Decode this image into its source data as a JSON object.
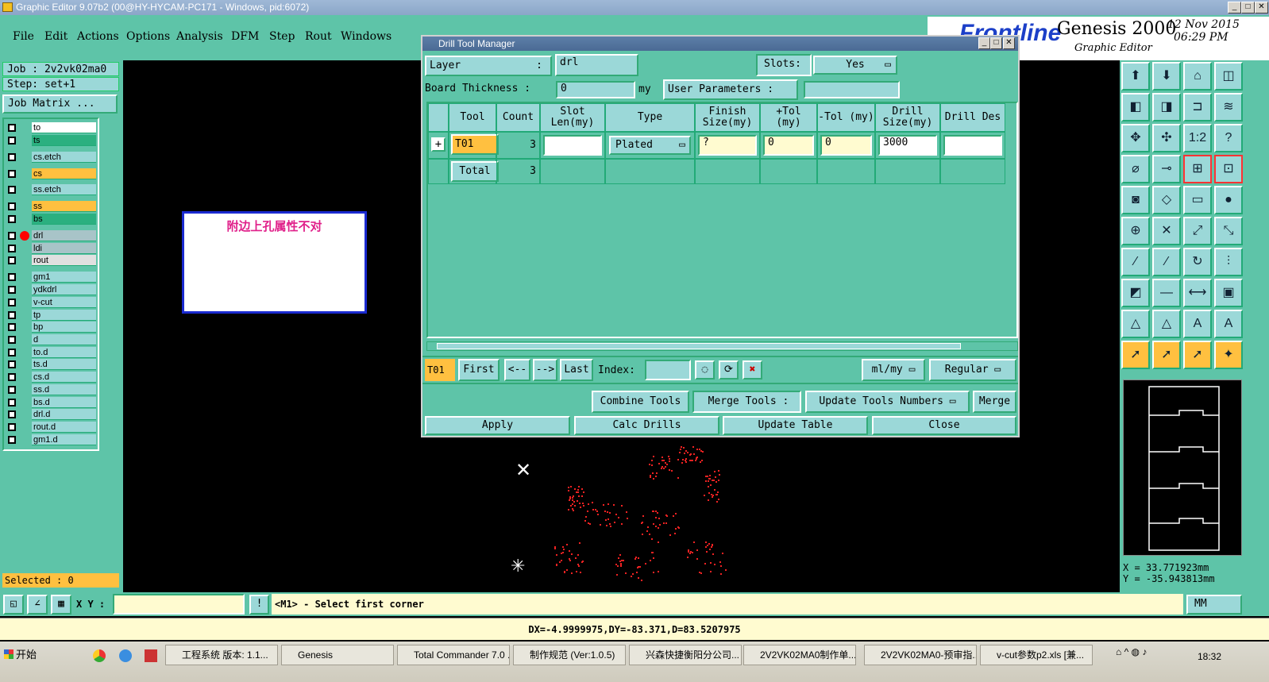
{
  "window": {
    "title": "Graphic Editor 9.07b2 (00@HY-HYCAM-PC171 - Windows, pid:6072)"
  },
  "menu": [
    "File",
    "Edit",
    "Actions",
    "Options",
    "Analysis",
    "DFM",
    "Step",
    "Rout",
    "Windows"
  ],
  "brand": {
    "logo": "Frontline",
    "product": "Genesis 2000",
    "subtitle": "Graphic Editor",
    "date": "12 Nov 2015",
    "time": "06:29 PM"
  },
  "job": {
    "job": "Job : 2v2vk02ma0",
    "step": "Step: set+1",
    "matrix_button": "Job Matrix ..."
  },
  "layers": [
    {
      "name": "to",
      "color": "#ffffff"
    },
    {
      "name": "ts",
      "color": "#2bb080"
    },
    {
      "name": "cs.etch",
      "color": "#9bd8d8"
    },
    {
      "name": "cs",
      "color": "#ffc040"
    },
    {
      "name": "ss.etch",
      "color": "#9bd8d8"
    },
    {
      "name": "ss",
      "color": "#ffc040"
    },
    {
      "name": "bs",
      "color": "#2bb080"
    },
    {
      "name": "drl",
      "color": "#a8c4c8"
    },
    {
      "name": "ldi",
      "color": "#a8c4c8"
    },
    {
      "name": "rout",
      "color": "#e0e0e0"
    },
    {
      "name": "gm1",
      "color": "#9bd8d8"
    },
    {
      "name": "ydkdrl",
      "color": "#9bd8d8"
    },
    {
      "name": "v-cut",
      "color": "#9bd8d8"
    },
    {
      "name": "tp",
      "color": "#9bd8d8"
    },
    {
      "name": "bp",
      "color": "#9bd8d8"
    },
    {
      "name": "d",
      "color": "#9bd8d8"
    },
    {
      "name": "to.d",
      "color": "#9bd8d8"
    },
    {
      "name": "ts.d",
      "color": "#9bd8d8"
    },
    {
      "name": "cs.d",
      "color": "#9bd8d8"
    },
    {
      "name": "ss.d",
      "color": "#9bd8d8"
    },
    {
      "name": "bs.d",
      "color": "#9bd8d8"
    },
    {
      "name": "drl.d",
      "color": "#9bd8d8"
    },
    {
      "name": "rout.d",
      "color": "#9bd8d8"
    },
    {
      "name": "gm1.d",
      "color": "#9bd8d8"
    }
  ],
  "selected": "Selected : 0",
  "note": "附边上孔属性不对",
  "dialog": {
    "title": "Drill Tool Manager",
    "layer_label": "Layer",
    "layer_colon": ":",
    "layer_value": "drl",
    "slots_label": "Slots:",
    "slots_value": "Yes",
    "board_thickness_label": "Board Thickness :",
    "board_thickness_value": "0",
    "board_thickness_unit": "my",
    "user_params_label": "User Parameters :",
    "user_params_value": "",
    "columns": [
      "Tool",
      "Count",
      "Slot Len(my)",
      "Type",
      "Finish Size(my)",
      "+Tol (my)",
      "-Tol (my)",
      "Drill Size(my)",
      "Drill Des"
    ],
    "rows": [
      {
        "tool": "T01",
        "count": "3",
        "slot_len": "",
        "type": "Plated",
        "finish": "?",
        "plus_tol": "0",
        "minus_tol": "0",
        "drill_size": "3000",
        "drill_des": ""
      }
    ],
    "total_label": "Total",
    "total_count": "3",
    "current_tool": "T01",
    "nav": {
      "first": "First",
      "prev": "<--",
      "next": "-->",
      "last": "Last",
      "index_label": "Index:",
      "index_value": ""
    },
    "units": "ml/my",
    "mode": "Regular",
    "combine": "Combine Tools",
    "merge_label": "Merge Tools :",
    "update_numbers": "Update Tools Numbers",
    "merge": "Merge",
    "apply": "Apply",
    "calc": "Calc Drills",
    "update_table": "Update Table",
    "close": "Close"
  },
  "coords": {
    "x": "X = 33.771923mm",
    "y": "Y = -35.943813mm"
  },
  "status": {
    "xy_label": "X Y :",
    "xy_value": "",
    "prompt": "<M1> - Select first corner",
    "units": "MM"
  },
  "message": "DX=-4.9999975,DY=-83.371,D=83.5207975",
  "taskbar": {
    "start": "开始",
    "tasks": [
      "工程系统  版本: 1.1...",
      "Genesis",
      "Total Commander 7.0 ...",
      "制作规范 (Ver:1.0.5)",
      "兴森快捷衡阳分公司...",
      "2V2VK02MA0制作单....",
      "2V2VK02MA0-预审指...",
      "v-cut参数p2.xls [兼..."
    ],
    "clock": "18:32"
  }
}
